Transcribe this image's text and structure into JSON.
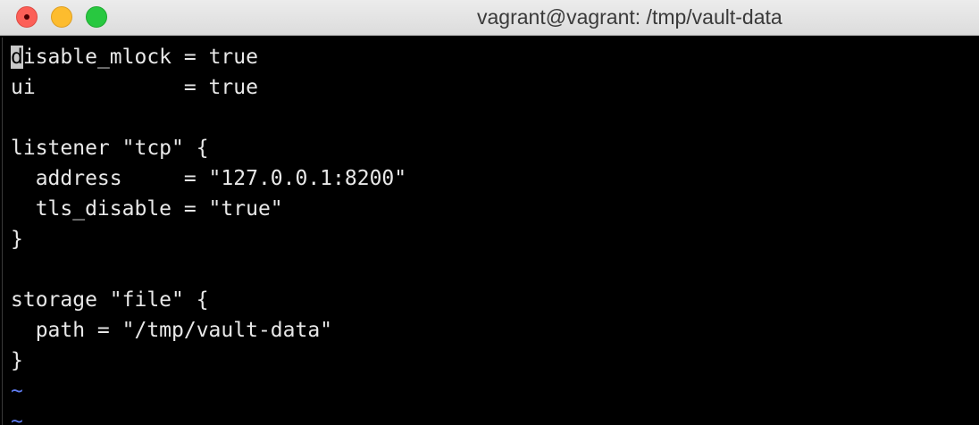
{
  "window": {
    "title": "vagrant@vagrant: /tmp/vault-data"
  },
  "editor": {
    "cursor_char": "d",
    "first_line_rest": "isable_mlock = true",
    "lines": [
      "ui            = true",
      "",
      "listener \"tcp\" {",
      "  address     = \"127.0.0.1:8200\"",
      "  tls_disable = \"true\"",
      "}",
      "",
      "storage \"file\" {",
      "  path = \"/tmp/vault-data\"",
      "}"
    ],
    "empty_line_marker": "~"
  },
  "colors": {
    "background": "#000000",
    "text": "#e8e8e8",
    "tilde": "#5f7cf0",
    "close": "#fc5f57",
    "minimize": "#fdbc2e",
    "zoom": "#28c840"
  }
}
